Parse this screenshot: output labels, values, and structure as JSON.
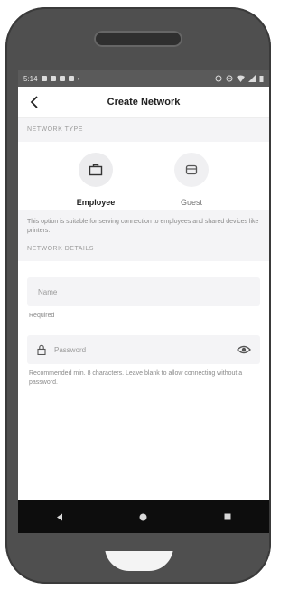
{
  "status_bar": {
    "time": "5:14",
    "indicator": "•"
  },
  "header": {
    "title": "Create Network",
    "back_icon": "chevron-left-icon"
  },
  "network_type": {
    "section_label": "NETWORK TYPE",
    "options": [
      {
        "label": "Employee",
        "icon": "briefcase-icon",
        "selected": true
      },
      {
        "label": "Guest",
        "icon": "guest-icon",
        "selected": false
      }
    ],
    "description": "This option is suitable for serving connection to employees and shared devices like printers."
  },
  "network_details": {
    "section_label": "NETWORK DETAILS",
    "name_placeholder": "Name",
    "name_helper": "Required",
    "password_placeholder": "Password",
    "password_helper": "Recommended min. 8 characters. Leave blank to allow connecting without a password."
  },
  "colors": {
    "section_bg": "#f4f4f6",
    "accent_text": "#222222",
    "muted_text": "#8a8a8a"
  }
}
